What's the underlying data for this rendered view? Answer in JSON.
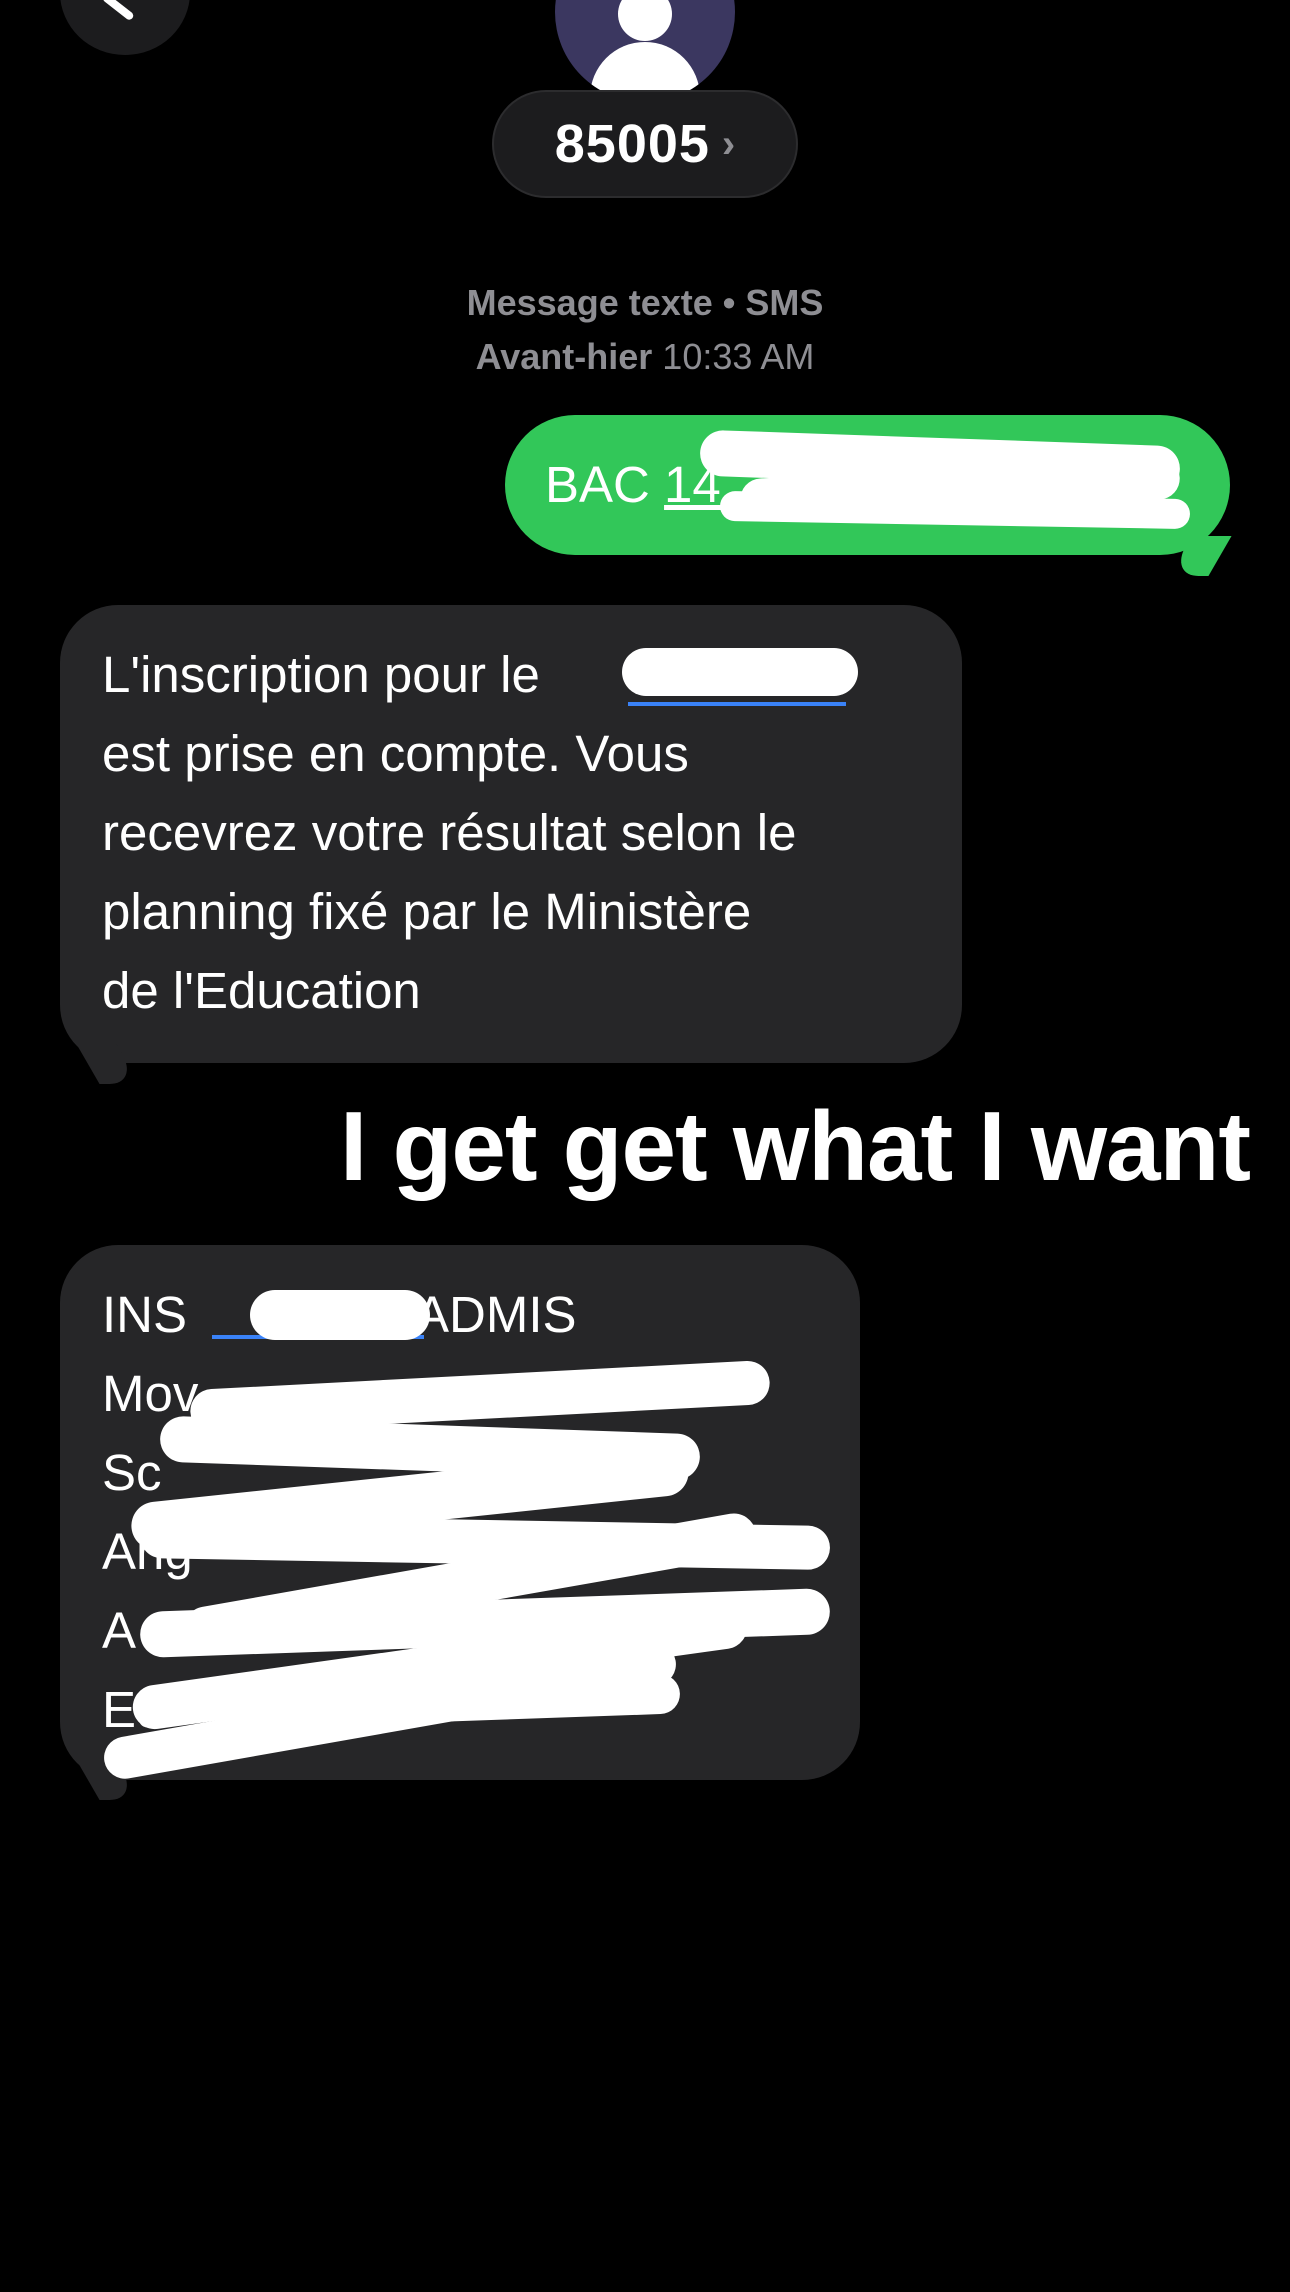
{
  "header": {
    "contact_name": "85005",
    "chevron": "›"
  },
  "thread_meta": {
    "service": "Message texte • SMS",
    "day": "Avant-hier",
    "time": "10:33 AM"
  },
  "messages": [
    {
      "direction": "sent",
      "prefix": "BAC ",
      "link_visible": "14",
      "redacted": true
    },
    {
      "direction": "received",
      "lines": [
        "L'inscription pour le",
        "est prise en compte. Vous",
        "recevrez votre résultat selon le",
        "planning fixé par le Ministère",
        "de l'Education"
      ],
      "redacted_link": true
    },
    {
      "direction": "received",
      "lines": [
        "INS",
        "ADMIS",
        "Mov",
        "Sc",
        "Ang",
        "A",
        "Ed"
      ],
      "redacted": true
    }
  ],
  "overlay_caption": "I get get what I want",
  "colors": {
    "background": "#000000",
    "sent_bubble": "#32c759",
    "received_bubble": "#262628",
    "link": "#3a82f7",
    "meta_text": "#8e8e93"
  },
  "icons": {
    "back": "chevron-left-icon",
    "avatar": "person-icon"
  }
}
